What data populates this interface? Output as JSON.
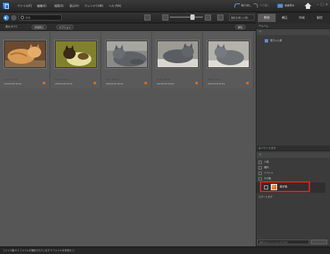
{
  "menu": {
    "items": [
      "ファイル(F)",
      "編集(E)",
      "検索(S)",
      "表示(V)",
      "ウィンドウ(W)",
      "ヘルプ(H)"
    ]
  },
  "top_right": {
    "undo_label": "取り消し",
    "redo_label": "やり直し",
    "display_label": "画面表示",
    "win_controls": [
      "−",
      "□",
      "×"
    ]
  },
  "toolbar": {
    "search_placeholder": "検索",
    "sort_label": "撮影日(新しい順)"
  },
  "filter_bar": {
    "show_label": "表示:すべて",
    "detail_label": "詳細表示",
    "option_label": "オプション",
    "right_label": "解除"
  },
  "tabs": [
    "整理",
    "補正",
    "作成",
    "配信"
  ],
  "grid": {
    "items": [
      {
        "stars": "★★★★★",
        "date": "2012/11/6 10:04"
      },
      {
        "stars": "★★★★★",
        "date": "2012/11/6 10:04"
      },
      {
        "stars": "★★★★★",
        "date": "2012/11/6 10:04"
      },
      {
        "stars": "★★★★★",
        "date": "2012/11/6 10:04"
      },
      {
        "stars": "★★★★★",
        "date": "2012/11/6 10:04"
      }
    ]
  },
  "right_panel": {
    "albums_header": "アルバム",
    "album_item": "猫ちゃん達",
    "keywords_header": "キーワードタグ",
    "tags": [
      "人物",
      "場所",
      "イベント",
      "その他"
    ],
    "selected_tag": "猫仔猫",
    "smart_tags": "スマートタグ",
    "bottom_input": "選択されたファイルにタグ付け",
    "bottom_btn": "追加"
  },
  "status": {
    "text": "ファイル数:5   5 ファイルが選択されています   0 ファイルを非表示   □"
  },
  "colors": {
    "badge": "#e06a1d",
    "highlight": "#e0201a",
    "accent": "#4a8fd6"
  }
}
